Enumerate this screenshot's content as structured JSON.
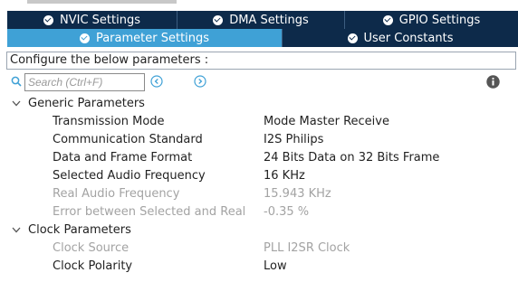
{
  "tabs": {
    "row1": [
      {
        "label": "NVIC Settings",
        "active": false
      },
      {
        "label": "DMA Settings",
        "active": false
      },
      {
        "label": "GPIO Settings",
        "active": false
      }
    ],
    "row2": [
      {
        "label": "Parameter Settings",
        "active": true
      },
      {
        "label": "User Constants",
        "active": false
      }
    ]
  },
  "configure_text": "Configure the below parameters :",
  "search": {
    "placeholder": "Search (Ctrl+F)"
  },
  "groups": [
    {
      "label": "Generic Parameters",
      "params": [
        {
          "name": "Transmission Mode",
          "value": "Mode Master Receive",
          "enabled": true
        },
        {
          "name": "Communication Standard",
          "value": "I2S Philips",
          "enabled": true
        },
        {
          "name": "Data and Frame Format",
          "value": "24 Bits Data on 32 Bits Frame",
          "enabled": true
        },
        {
          "name": "Selected Audio Frequency",
          "value": "16 KHz",
          "enabled": true
        },
        {
          "name": "Real Audio Frequency",
          "value": "15.943 KHz",
          "enabled": false
        },
        {
          "name": "Error between Selected and Real",
          "value": "-0.35 %",
          "enabled": false
        }
      ]
    },
    {
      "label": "Clock Parameters",
      "params": [
        {
          "name": "Clock Source",
          "value": "PLL I2SR Clock",
          "enabled": false
        },
        {
          "name": "Clock Polarity",
          "value": "Low",
          "enabled": true
        }
      ]
    }
  ],
  "colors": {
    "tab_bg": "#0d2a4a",
    "tab_active": "#3fa1d6",
    "disabled_text": "#a3a3a3",
    "icon_blue": "#3fa1d6"
  }
}
